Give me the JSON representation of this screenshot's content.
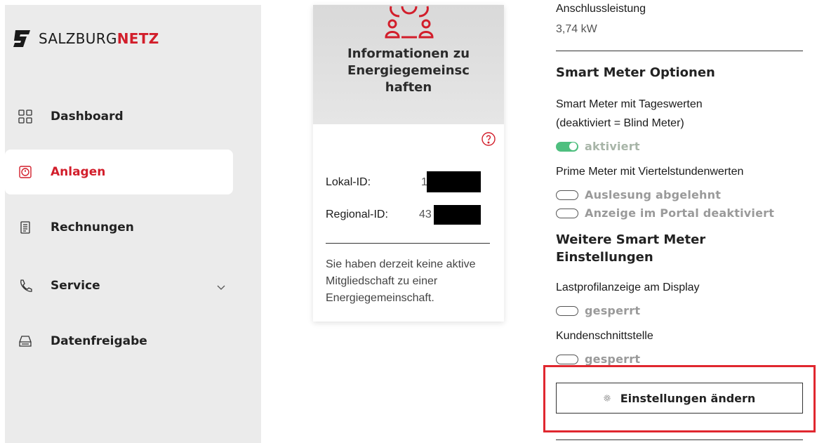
{
  "brand": {
    "name_light": "SALZBURG",
    "name_bold": "NETZ",
    "accent": "#d21e2b"
  },
  "sidebar": {
    "items": [
      {
        "label": "Dashboard",
        "icon": "grid-icon",
        "active": false
      },
      {
        "label": "Anlagen",
        "icon": "meter-icon",
        "active": true
      },
      {
        "label": "Rechnungen",
        "icon": "document-icon",
        "active": false
      },
      {
        "label": "Service",
        "icon": "phone-icon",
        "active": false,
        "has_chevron": true
      },
      {
        "label": "Datenfreigabe",
        "icon": "tray-icon",
        "active": false
      }
    ]
  },
  "card": {
    "title": "Informationen zu Energiegemeinsc haften",
    "lokal_label": "Lokal-ID:",
    "lokal_value": "1",
    "regional_label": "Regional-ID:",
    "regional_value": "43",
    "text": "Sie haben derzeit keine aktive Mitgliedschaft zu einer Energiegemeinschaft."
  },
  "right": {
    "anschluss_label": "Anschlussleistung",
    "anschluss_value": "3,74 kW",
    "smart_heading": "Smart Meter Optionen",
    "tageswerte_label_1": "Smart Meter mit Tageswerten",
    "tageswerte_label_2": "(deaktiviert = Blind Meter)",
    "tageswerte_toggle": "aktiviert",
    "prime_label": "Prime Meter mit Viertelstundenwerten",
    "prime_toggle_1": "Auslesung abgelehnt",
    "prime_toggle_2": "Anzeige im Portal deaktiviert",
    "weitere_heading_1": "Weitere Smart Meter",
    "weitere_heading_2": "Einstellungen",
    "lastprofil_label": "Lastprofilanzeige am Display",
    "lastprofil_toggle": "gesperrt",
    "kunden_label": "Kundenschnittstelle",
    "kunden_toggle": "gesperrt",
    "button_label": "Einstellungen ändern"
  }
}
